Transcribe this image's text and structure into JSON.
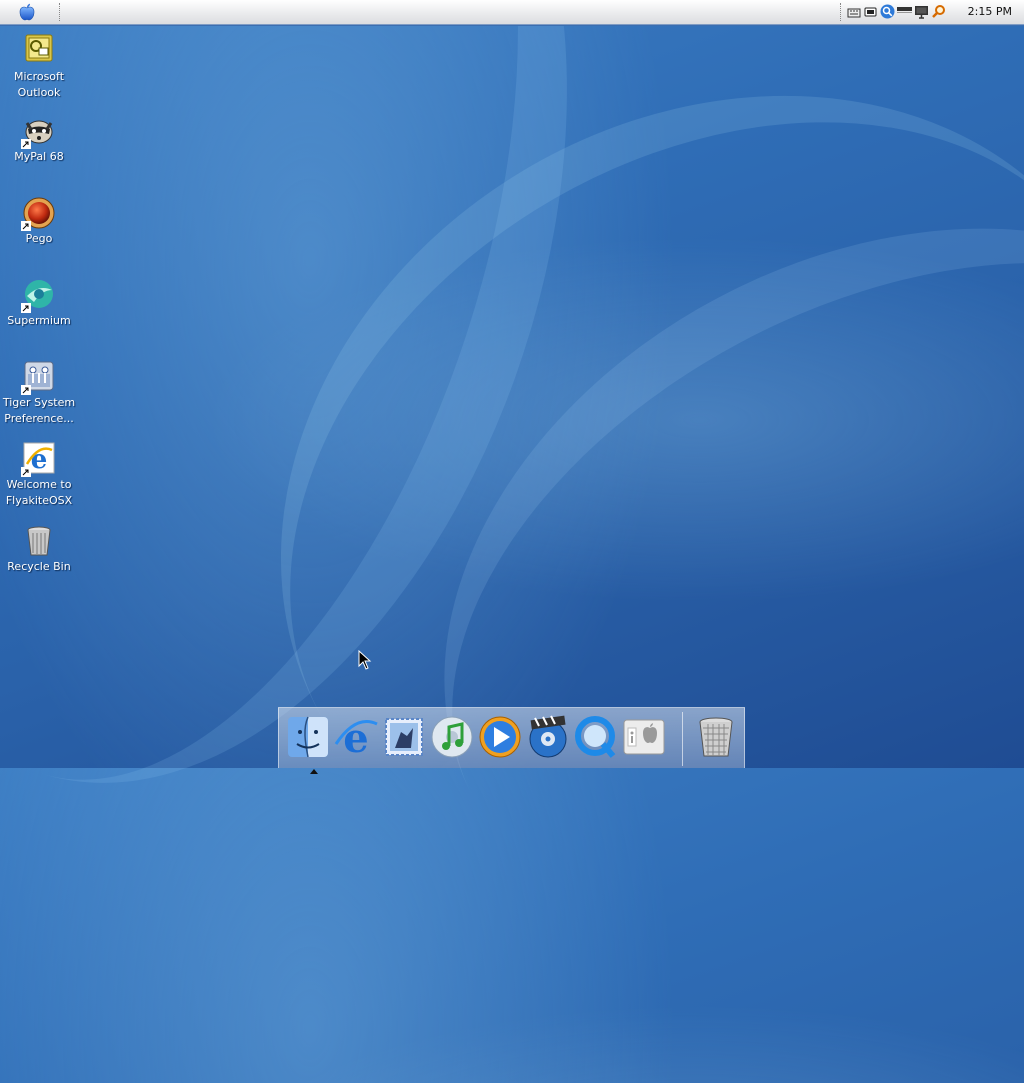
{
  "menubar": {
    "apple_menu": "apple-icon",
    "tray_icons": [
      "keyboard-icon",
      "battery-icon",
      "search-icon",
      "window-icon",
      "display-icon",
      "spotlight-icon"
    ],
    "clock": "2:15 PM"
  },
  "desktop": {
    "icons": [
      {
        "label_line1": "Microsoft",
        "label_line2": "Outlook",
        "icon": "outlook-icon"
      },
      {
        "label_line1": "MyPal 68",
        "label_line2": "",
        "icon": "mypal-icon"
      },
      {
        "label_line1": "Pego",
        "label_line2": "",
        "icon": "pego-icon"
      },
      {
        "label_line1": "Supermium",
        "label_line2": "",
        "icon": "supermium-icon"
      },
      {
        "label_line1": "Tiger System",
        "label_line2": "Preference...",
        "icon": "system-preferences-icon"
      },
      {
        "label_line1": "Welcome to",
        "label_line2": "FlyakiteOSX",
        "icon": "internet-explorer-icon"
      },
      {
        "label_line1": "Recycle Bin",
        "label_line2": "",
        "icon": "recycle-bin-icon"
      }
    ]
  },
  "dock": {
    "items": [
      "finder-icon",
      "internet-explorer-icon",
      "mail-icon",
      "itunes-icon",
      "media-player-icon",
      "dvd-player-icon",
      "quicktime-icon",
      "system-info-icon",
      "trash-icon"
    ]
  }
}
